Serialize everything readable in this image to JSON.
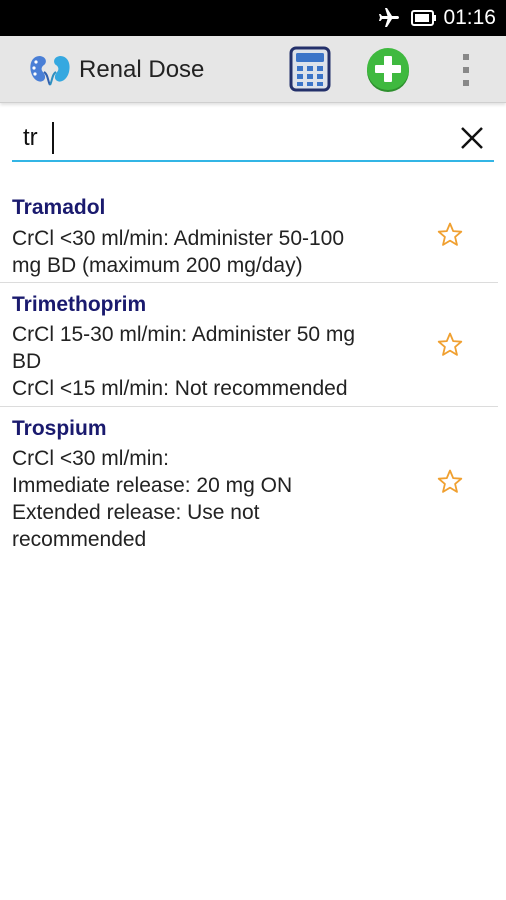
{
  "status_bar": {
    "time": "01:16"
  },
  "action_bar": {
    "title": "Renal Dose"
  },
  "search": {
    "query": "tr"
  },
  "drugs": [
    {
      "name": "Tramadol",
      "lines": [
        "CrCl <30 ml/min: Administer 50-100",
        "mg BD (maximum 200 mg/day)"
      ]
    },
    {
      "name": "Trimethoprim",
      "lines": [
        "CrCl 15-30 ml/min: Administer 50 mg",
        "BD",
        "CrCl <15 ml/min: Not recommended"
      ]
    },
    {
      "name": "Trospium",
      "lines": [
        "CrCl <30 ml/min:",
        "Immediate release: 20 mg ON",
        "Extended release: Use not",
        "recommended"
      ]
    }
  ],
  "colors": {
    "accent": "#33b5e5",
    "drug_name": "#1a1a6e",
    "star": "#f0a030",
    "add_green": "#3fb93f"
  }
}
